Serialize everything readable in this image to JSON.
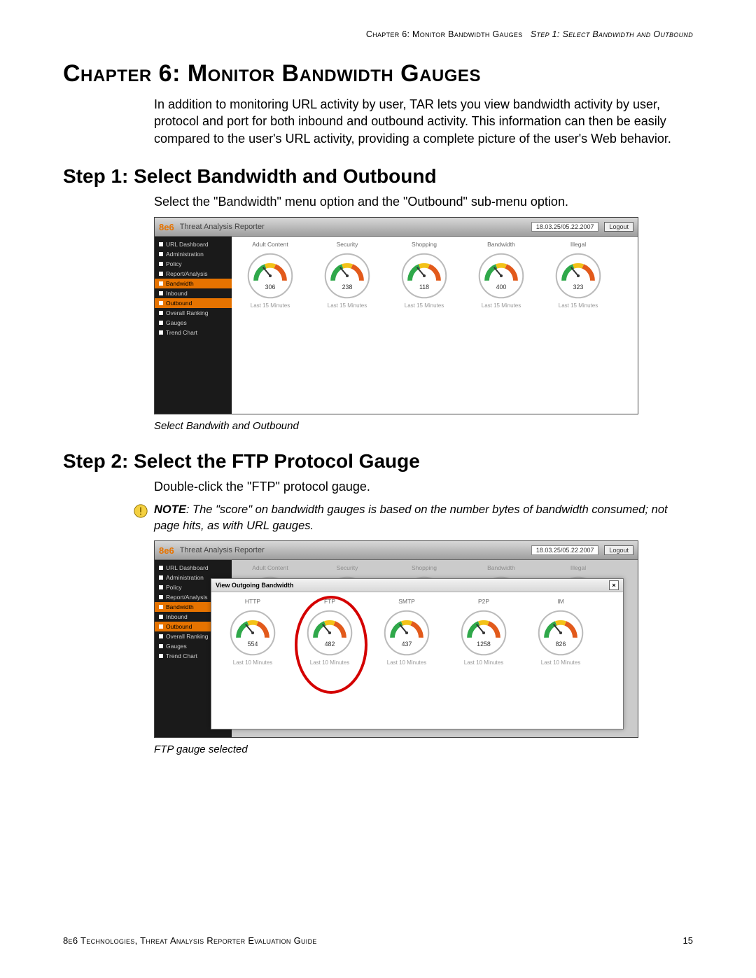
{
  "header": {
    "chapter_ref": "Chapter 6: Monitor Bandwidth Gauges",
    "step_ref": "Step 1: Select Bandwidth and Outbound"
  },
  "chapter_title": "Chapter 6: Monitor Bandwidth Gauges",
  "intro": "In addition to monitoring URL activity by user, TAR lets you view bandwidth activity by user, protocol and port for both inbound and outbound activity. This information can then be easily compared to the user's URL activity, providing a complete picture of the user's Web behavior.",
  "step1_title": "Step 1: Select Bandwidth and Outbound",
  "step1_body": "Select the \"Bandwidth\" menu option and the \"Outbound\" sub-menu option.",
  "caption1": "Select Bandwith and Outbound",
  "step2_title": "Step 2: Select the FTP Protocol Gauge",
  "step2_body": "Double-click the \"FTP\" protocol gauge.",
  "note_label": "NOTE",
  "note_body": ": The \"score\" on bandwidth gauges is based on the number bytes of bandwidth consumed; not page hits, as with URL gauges.",
  "caption2": "FTP gauge selected",
  "footer": {
    "left": "8e6 Technologies, Threat Analysis Reporter Evaluation Guide",
    "page": "15"
  },
  "app": {
    "title": "Threat Analysis Reporter",
    "logo": "8e6",
    "datetime": "18.03.25/05.22.2007",
    "logout": "Logout",
    "sidebar": [
      {
        "label": "URL Dashboard",
        "active": false
      },
      {
        "label": "Administration",
        "active": false
      },
      {
        "label": "Policy",
        "active": false
      },
      {
        "label": "Report/Analysis",
        "active": false
      },
      {
        "label": "Bandwidth",
        "active": true
      },
      {
        "label": "Inbound",
        "active": false
      },
      {
        "label": "Outbound",
        "active": true
      },
      {
        "label": "Overall Ranking",
        "active": false
      },
      {
        "label": "Gauges",
        "active": false
      },
      {
        "label": "Trend Chart",
        "active": false
      }
    ],
    "gauges1": [
      {
        "title": "Adult Content",
        "value": 306,
        "sub": "Last 15 Minutes"
      },
      {
        "title": "Security",
        "value": 238,
        "sub": "Last 15 Minutes"
      },
      {
        "title": "Shopping",
        "value": 118,
        "sub": "Last 15 Minutes"
      },
      {
        "title": "Bandwidth",
        "value": 400,
        "sub": "Last 15 Minutes"
      },
      {
        "title": "Illegal",
        "value": 323,
        "sub": "Last 15 Minutes"
      }
    ],
    "secondary_title": "View Outgoing Bandwidth",
    "gauges2": [
      {
        "title": "HTTP",
        "value": 554,
        "sub": "Last 10 Minutes"
      },
      {
        "title": "FTP",
        "value": 482,
        "sub": "Last 10 Minutes"
      },
      {
        "title": "SMTP",
        "value": 437,
        "sub": "Last 10 Minutes"
      },
      {
        "title": "P2P",
        "value": 1258,
        "sub": "Last 10 Minutes"
      },
      {
        "title": "IM",
        "value": 826,
        "sub": "Last 10 Minutes"
      }
    ],
    "gauges2_circled_index": 1
  }
}
